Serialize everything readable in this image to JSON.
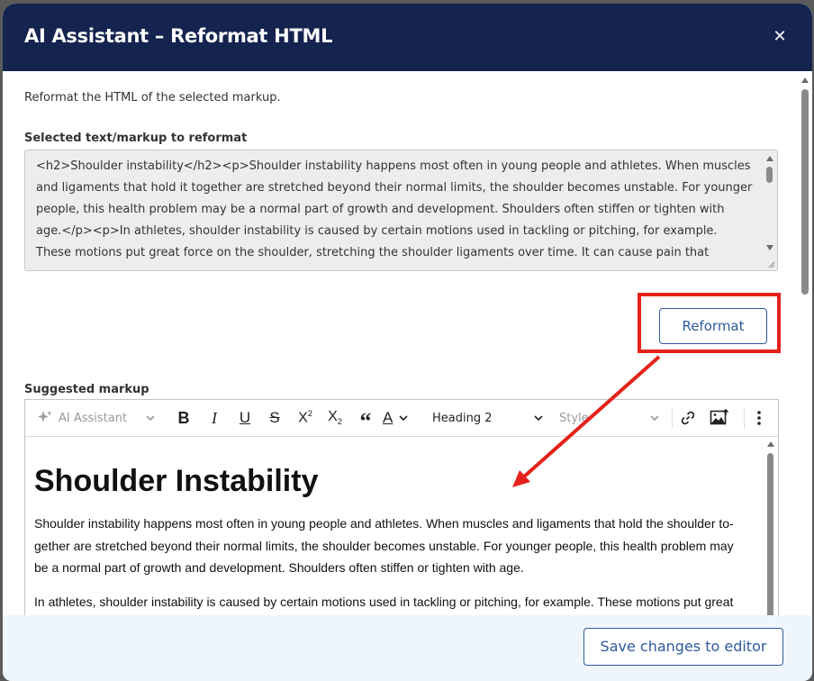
{
  "dialog": {
    "title": "AI Assistant – Reformat HTML",
    "close_icon": "close-icon"
  },
  "description": "Reformat the HTML of the selected markup.",
  "selected": {
    "label": "Selected text/markup to reformat",
    "text": "<h2>Shoulder instability</h2><p>Shoulder instability happens most often in young people and athletes. When muscles and ligaments that hold it together are stretched beyond their normal limits, the shoulder becomes unstable. For younger people, this health problem may be a normal part of growth and development. Shoulders often stiffen or tighten with age.</p><p>In athletes, shoulder instability is caused by certain motions used in tackling or pitching, for example. These motions put great force on the shoulder, stretching the shoulder ligaments over time. It can cause pain that"
  },
  "reformat_button": "Reformat",
  "suggested": {
    "label": "Suggested markup",
    "toolbar": {
      "ai_assistant": "AI Assistant",
      "heading_select": "Heading 2",
      "style_select": "Style",
      "superscript_mark": "2",
      "subscript_mark": "2"
    },
    "heading": "Shoulder Instability",
    "paragraphs": [
      "Shoulder instability happens most often in young people and athletes. When muscles and ligaments that hold the shoulder to­gether are stretched beyond their normal limits, the shoulder becomes unstable. For younger people, this health problem may be a normal part of growth and development. Shoulders often stiffen or tighten with age.",
      "In athletes, shoulder instability is caused by certain motions used in tackling or pitching, for example. These motions put great force on the shoulder, stretching the shoulder ligaments over time."
    ]
  },
  "footer": {
    "save_button": "Save changes to editor"
  },
  "colors": {
    "header_bg": "#14244f",
    "accent": "#2e5a9c",
    "annotation_red": "#e4221b"
  }
}
